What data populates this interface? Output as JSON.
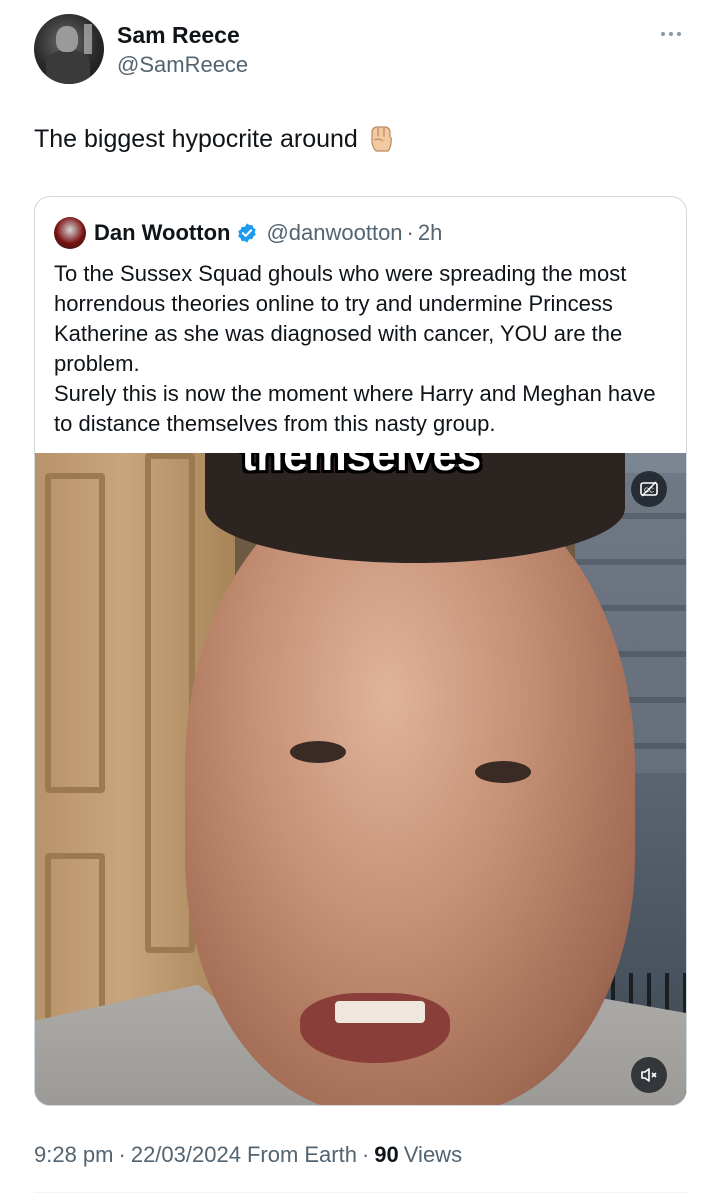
{
  "author": {
    "name": "Sam Reece",
    "handle": "@SamReece"
  },
  "tweet": {
    "text": "The biggest hypocrite around",
    "emoji": "raised-fist-icon"
  },
  "quoted_tweet": {
    "name": "Dan Wootton",
    "handle": "@danwootton",
    "separator": "·",
    "time": "2h",
    "verified": true,
    "paragraphs": [
      "To the Sussex Squad ghouls who were spreading the most horrendous theories online to try and undermine Princess Katherine as she was diagnosed with cancer, YOU are the problem.",
      "Surely this is now the moment where Harry and Meghan have to distance themselves from this nasty group."
    ],
    "media": {
      "caption": "themselves",
      "cc_icon": "closed-captions-icon",
      "mute_icon": "volume-muted-icon"
    }
  },
  "meta": {
    "time": "9:28 pm",
    "sep1": "·",
    "date": "22/03/2024",
    "source": "From Earth",
    "sep2": "·",
    "views_count": "90",
    "views_label": "Views"
  },
  "colors": {
    "text": "#0f1419",
    "secondary": "#536471",
    "border": "#cfd9de",
    "verified": "#1d9bf0"
  }
}
